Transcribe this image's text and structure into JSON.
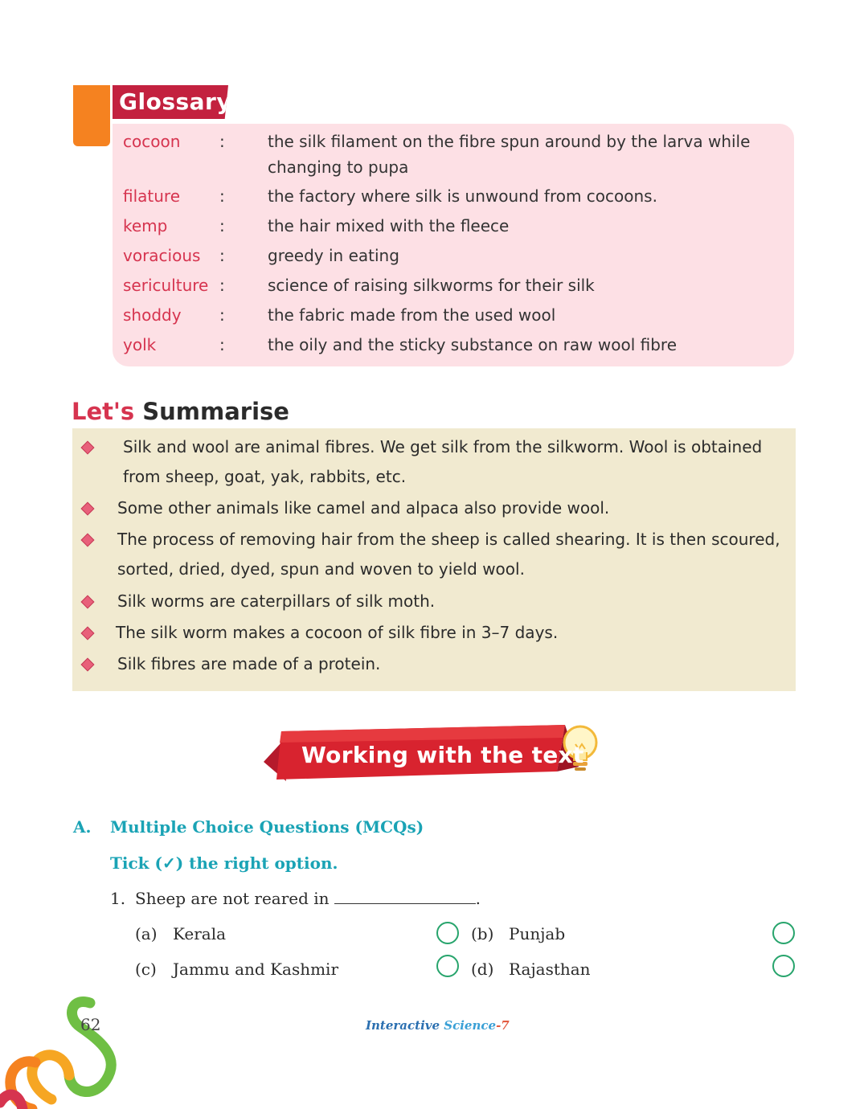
{
  "glossary": {
    "title": "Glossary",
    "entries": [
      {
        "term": "cocoon",
        "sep": ":",
        "def": "the silk filament on the fibre spun around by the larva while changing to pupa"
      },
      {
        "term": "filature",
        "sep": ":",
        "def": "the factory where silk is unwound from cocoons."
      },
      {
        "term": "kemp",
        "sep": ":",
        "def": "the hair mixed with the fleece"
      },
      {
        "term": "voracious",
        "sep": ":",
        "def": "greedy in eating"
      },
      {
        "term": "sericulture",
        "sep": ":",
        "def": "science of raising silkworms for their silk"
      },
      {
        "term": "shoddy",
        "sep": ":",
        "def": "the fabric made from the used wool"
      },
      {
        "term": "yolk",
        "sep": ":",
        "def": "the oily and the sticky substance on raw wool fibre"
      }
    ]
  },
  "summary": {
    "heading_lets": "Let's",
    "heading_summarise": "Summarise",
    "points": [
      "Silk and wool are animal fibres. We get silk from the silkworm. Wool is obtained from sheep, goat, yak, rabbits, etc.",
      "Some other animals like camel and alpaca also provide wool.",
      "The process of removing hair from the sheep is called shearing. It is then scoured, sorted, dried, dyed, spun and woven to yield wool.",
      "Silk worms are caterpillars of silk moth.",
      "The silk worm makes a cocoon of silk fibre in 3–7 days.",
      "Silk fibres are made of a protein."
    ]
  },
  "banner": {
    "text": "Working with the text",
    "icon": "lightbulb-icon"
  },
  "mcq": {
    "section_letter": "A.",
    "section_title": "Multiple Choice Questions (MCQs)",
    "instruction": "Tick (✓) the right option.",
    "questions": [
      {
        "number": "1.",
        "text": "Sheep are not reared in",
        "end": ".",
        "options": [
          {
            "key": "(a)",
            "label": "Kerala"
          },
          {
            "key": "(b)",
            "label": "Punjab"
          },
          {
            "key": "(c)",
            "label": "Jammu and Kashmir"
          },
          {
            "key": "(d)",
            "label": "Rajasthan"
          }
        ]
      }
    ]
  },
  "footer": {
    "page_number": "62",
    "title_part1": "Interactive",
    "title_part2": " Science",
    "title_part3": "-7"
  },
  "colors": {
    "accent_red": "#c3213f",
    "accent_orange": "#f58220",
    "glossary_bg": "#fde0e5",
    "summary_bg": "#f1ead0",
    "mcq_teal": "#1aa3b5",
    "option_circle": "#27a46c"
  }
}
